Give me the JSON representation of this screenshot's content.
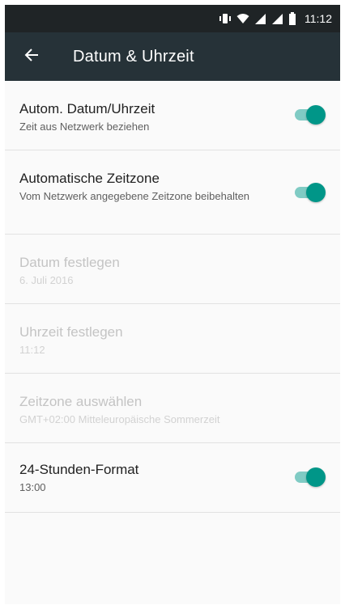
{
  "status_bar": {
    "time": "11:12",
    "icons": [
      "vibrate-icon",
      "wifi-icon",
      "signal-icon",
      "signal-icon",
      "battery-icon"
    ]
  },
  "app_bar": {
    "title": "Datum & Uhrzeit",
    "back_icon": "arrow-back-icon"
  },
  "colors": {
    "status_bar": "#1f2426",
    "app_bar": "#263238",
    "accent": "#009688",
    "accent_track": "#80cbc4"
  },
  "settings": [
    {
      "title": "Autom. Datum/Uhrzeit",
      "summary": "Zeit aus Netzwerk beziehen",
      "enabled": true,
      "toggle": true,
      "checked": true
    },
    {
      "title": "Automatische Zeitzone",
      "summary": "Vom Netzwerk angegebene Zeitzone beibehalten",
      "enabled": true,
      "toggle": true,
      "checked": true
    },
    {
      "title": "Datum festlegen",
      "summary": "6. Juli 2016",
      "enabled": false,
      "toggle": false
    },
    {
      "title": "Uhrzeit festlegen",
      "summary": "11:12",
      "enabled": false,
      "toggle": false
    },
    {
      "title": "Zeitzone auswählen",
      "summary": "GMT+02:00 Mitteleuropäische Sommerzeit",
      "enabled": false,
      "toggle": false
    },
    {
      "title": "24-Stunden-Format",
      "summary": "13:00",
      "enabled": true,
      "toggle": true,
      "checked": true
    }
  ]
}
